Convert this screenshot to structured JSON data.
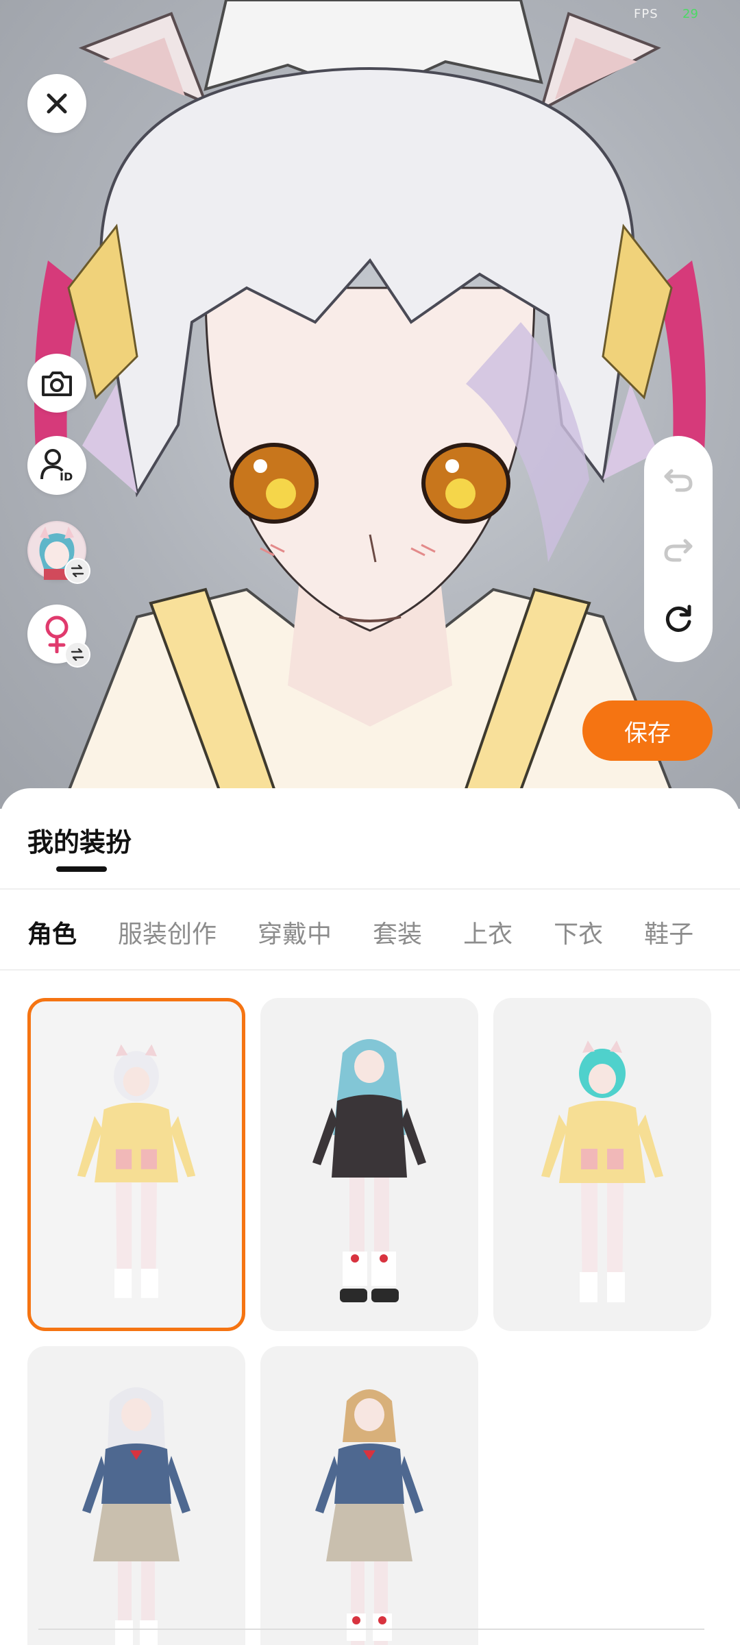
{
  "status": {
    "fps_label": "FPS",
    "fps_value": "29"
  },
  "viewport": {
    "close_icon": "close-icon",
    "camera_icon": "camera-icon",
    "avatar_id_icon": "user-id-icon",
    "gender_icon": "female-icon",
    "swap_icon": "swap-icon",
    "undo_icon": "undo-icon",
    "redo_icon": "redo-icon",
    "reset_icon": "reset-icon"
  },
  "save_button": {
    "label": "保存"
  },
  "sheet": {
    "title": "我的装扮",
    "tabs": [
      {
        "label": "角色",
        "active": true
      },
      {
        "label": "服装创作"
      },
      {
        "label": "穿戴中"
      },
      {
        "label": "套装"
      },
      {
        "label": "上衣"
      },
      {
        "label": "下衣"
      },
      {
        "label": "鞋子"
      }
    ]
  },
  "characters": [
    {
      "name": "white-hair-cat-ear-yellow-hoodie",
      "selected": true
    },
    {
      "name": "blue-hair-black-hoodie"
    },
    {
      "name": "cyan-hair-cat-ear-yellow-hoodie"
    },
    {
      "name": "silver-hair-school-uniform"
    },
    {
      "name": "brown-hair-school-uniform"
    }
  ],
  "colors": {
    "accent": "#f57412",
    "fps_value": "#4cd964"
  }
}
